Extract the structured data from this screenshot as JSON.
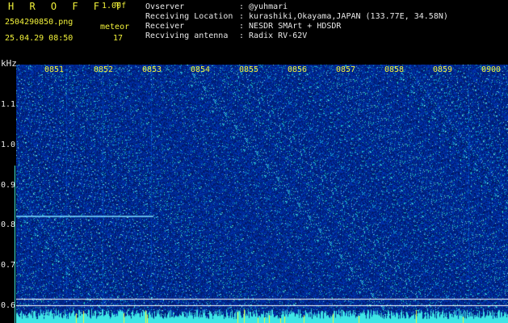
{
  "header": {
    "brand": "H R O F F T",
    "version": "1.00f",
    "filename": "2504290850.png",
    "datetime": "25.04.29 08:50",
    "meteor_label": "meteor",
    "meteor_count": "17"
  },
  "info": [
    {
      "key": "Ovserver",
      "value": ": @yuhmari"
    },
    {
      "key": "Receiving Location",
      "value": ": kurashiki,Okayama,JAPAN (133.77E, 34.58N)"
    },
    {
      "key": "Receiver",
      "value": ": NESDR SMArt + HDSDR"
    },
    {
      "key": "Recviving antenna",
      "value": ": Radix RV-62V"
    }
  ],
  "axis": {
    "unit": "kHz",
    "time_ticks": [
      "0851",
      "0852",
      "0853",
      "0854",
      "0855",
      "0856",
      "0857",
      "0858",
      "0859",
      "0900"
    ],
    "freq_ticks": [
      "1.1",
      "1.0",
      "0.9",
      "0.8",
      "0.7",
      "0.6"
    ]
  },
  "colors": {
    "background": "#0b1670",
    "label_yellow": "#f2f23a",
    "label_cyan": "#3ee6e6"
  }
}
